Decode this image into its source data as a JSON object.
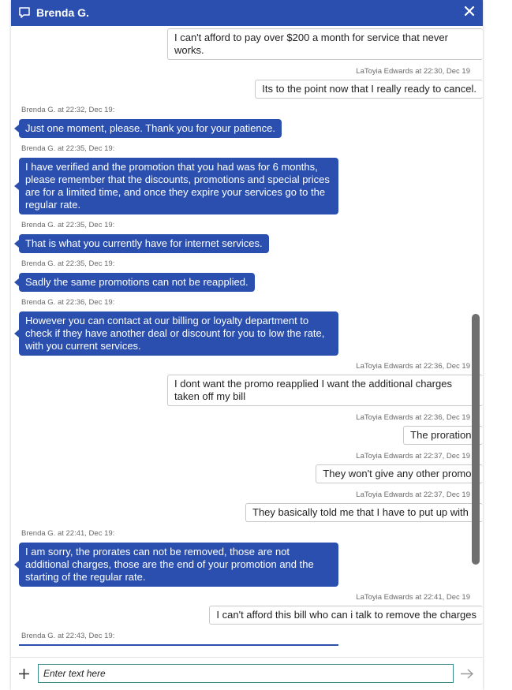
{
  "header": {
    "title": "Brenda G.",
    "chat_icon": "chat-bubble-icon",
    "close_icon": "close-icon"
  },
  "messages": [
    {
      "sender": "user",
      "text": "I can't afford to pay over $200 a month for service that never works.",
      "meta": ""
    },
    {
      "sender": "user",
      "text": "Its to the point now that I really ready to cancel.",
      "meta": "LaToyia Edwards at 22:30, Dec 19"
    },
    {
      "sender": "agent",
      "text": "Just one moment, please. Thank you for your patience.",
      "meta": "Brenda G. at 22:32, Dec 19:"
    },
    {
      "sender": "agent",
      "text": "I have verified and the promotion that you had was for 6 months, please remember that the discounts, promotions and special prices are for a limited time, and once they expire your services go to the regular rate.",
      "meta": "Brenda G. at 22:35, Dec 19:"
    },
    {
      "sender": "agent",
      "text": "That is what you currently have for internet services.",
      "meta": "Brenda G. at 22:35, Dec 19:"
    },
    {
      "sender": "agent",
      "text": "Sadly the same promotions can not be reapplied.",
      "meta": "Brenda G. at 22:35, Dec 19:"
    },
    {
      "sender": "agent",
      "text": "However you can contact at our billing or loyalty department to check if they have another deal or discount for you to low the rate, with you current services.",
      "meta": "Brenda G. at 22:36, Dec 19:"
    },
    {
      "sender": "user",
      "text": "I dont want the promo reapplied I want the additional charges taken off my bill",
      "meta": "LaToyia Edwards at 22:36, Dec 19"
    },
    {
      "sender": "user",
      "text": "The prorations",
      "meta": "LaToyia Edwards at 22:36, Dec 19"
    },
    {
      "sender": "user",
      "text": "They won't give any other promos",
      "meta": "LaToyia Edwards at 22:37, Dec 19"
    },
    {
      "sender": "user",
      "text": "They basically told me that I have to put up with it",
      "meta": "LaToyia Edwards at 22:37, Dec 19"
    },
    {
      "sender": "agent",
      "text": "I am sorry, the prorates can not be removed, those are not additional charges, those are the end of your promotion and the starting of the regular rate.",
      "meta": "Brenda G. at 22:41, Dec 19:"
    },
    {
      "sender": "user",
      "text": "I can't afford this bill who can i talk to remove the charges",
      "meta": "LaToyia Edwards at 22:41, Dec 19"
    }
  ],
  "trailing_meta": "Brenda G. at 22:43, Dec 19:",
  "composer": {
    "placeholder": "Enter text here",
    "plus_icon": "plus-icon",
    "send_icon": "send-arrow-icon"
  },
  "colors": {
    "header_bg": "#2a4fae",
    "agent_bubble": "#2a4fae",
    "input_border": "#3e8c8c"
  }
}
